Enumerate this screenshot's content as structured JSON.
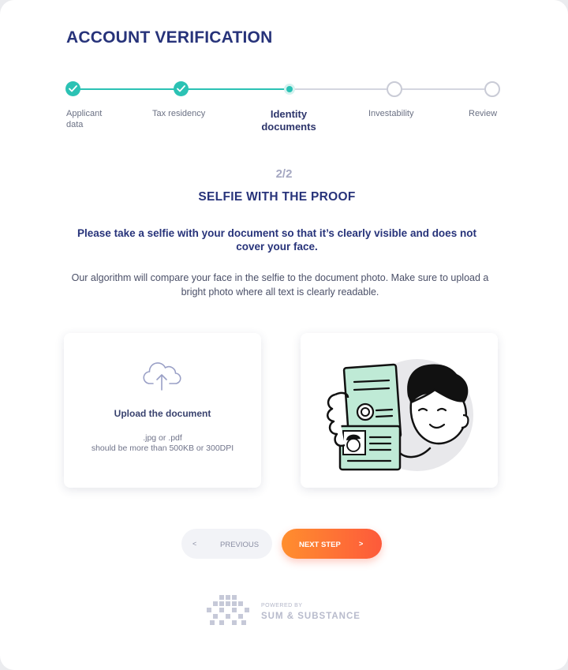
{
  "page": {
    "title": "ACCOUNT VERIFICATION"
  },
  "stepper": {
    "steps": [
      {
        "label": "Applicant\ndata",
        "status": "done"
      },
      {
        "label": "Tax residency",
        "status": "done"
      },
      {
        "label": "Identity\ndocuments",
        "status": "current"
      },
      {
        "label": "Investability",
        "status": "todo"
      },
      {
        "label": "Review",
        "status": "todo"
      }
    ],
    "colors": {
      "done": "#2bc2b4",
      "todo": "#c9cbd6"
    }
  },
  "section": {
    "counter": "2/2",
    "heading": "SELFIE WITH THE PROOF",
    "instruction": "Please take a selfie with your document so that it’s clearly visible and does not cover your face.",
    "description": "Our algorithm will compare your face in the selfie to the document photo. Make sure to upload a bright photo where all text is clearly readable."
  },
  "upload": {
    "icon": "cloud-upload-icon",
    "title": "Upload the document",
    "formats": ".jpg or .pdf",
    "requirement": "should be more than 500KB or 300DPI"
  },
  "buttons": {
    "previous": "PREVIOUS",
    "previous_icon": "<",
    "next": "NEXT STEP",
    "next_icon": ">"
  },
  "footer": {
    "powered_by": "POWERED BY",
    "brand": "SUM & SUBSTANCE"
  },
  "colors": {
    "primary": "#27337a",
    "accent_start": "#ff8e2e",
    "accent_end": "#fd5a3b"
  }
}
